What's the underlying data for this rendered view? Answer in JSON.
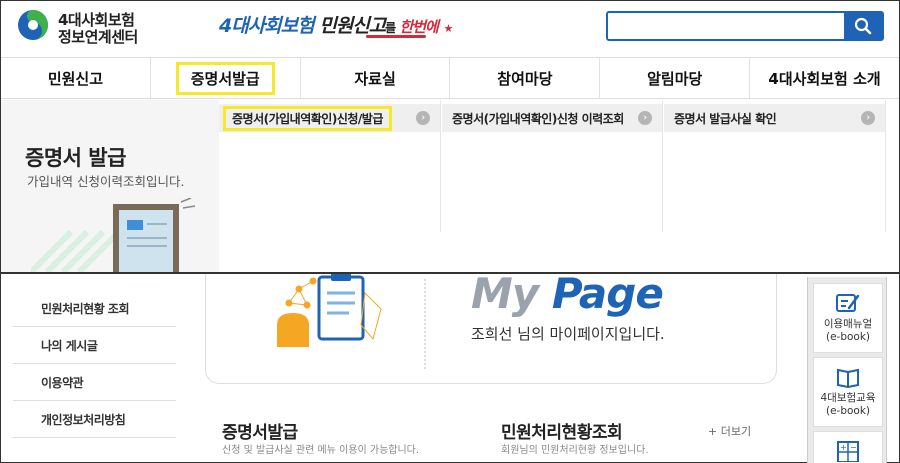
{
  "header": {
    "logo_line1": "4대사회보험",
    "logo_line2": "정보연계센터",
    "slogan_part1": "4대사회보험",
    "slogan_part2": " 민원신고",
    "slogan_part3": "를",
    "slogan_part4": " 한번에",
    "search": {
      "value": "",
      "placeholder": ""
    }
  },
  "gnb": {
    "items": [
      {
        "label": "민원신고"
      },
      {
        "label": "증명서발급"
      },
      {
        "label": "자료실"
      },
      {
        "label": "참여마당"
      },
      {
        "label": "알림마당"
      },
      {
        "label": "4대사회보험 소개"
      }
    ]
  },
  "dropdown": {
    "title": "증명서 발급",
    "desc": "가입내역 신청이력조회입니다.",
    "columns": [
      {
        "label": "증명서(가입내역확인)신청/발급"
      },
      {
        "label": "증명서(가입내역확인)신청 이력조회"
      },
      {
        "label": "증명서 발급사실 확인"
      }
    ]
  },
  "lnb": {
    "items": [
      {
        "label": "민원처리현황 조회"
      },
      {
        "label": "나의 게시글"
      },
      {
        "label": "이용약관"
      },
      {
        "label": "개인정보처리방침"
      }
    ]
  },
  "mypage": {
    "title_my": "My",
    "title_page": "Page",
    "subtitle": "조희선 님의 마이페이지입니다."
  },
  "sections": {
    "cert_title": "증명서발급",
    "cert_desc": "신청 및 발급사실 관련 메뉴 이용이 가능합니다.",
    "status_title": "민원처리현황조회",
    "status_desc": "회원님의 민원처리현황 정보입니다.",
    "more": "+ 더보기"
  },
  "quick": {
    "items": [
      {
        "label1": "이용매뉴얼",
        "label2": "(e-book)"
      },
      {
        "label1": "4대보험교육",
        "label2": "(e-book)"
      }
    ]
  },
  "colors": {
    "brand_blue": "#1e63b6",
    "highlight_yellow": "#f4ea2a",
    "accent_red": "#d42a3b"
  }
}
